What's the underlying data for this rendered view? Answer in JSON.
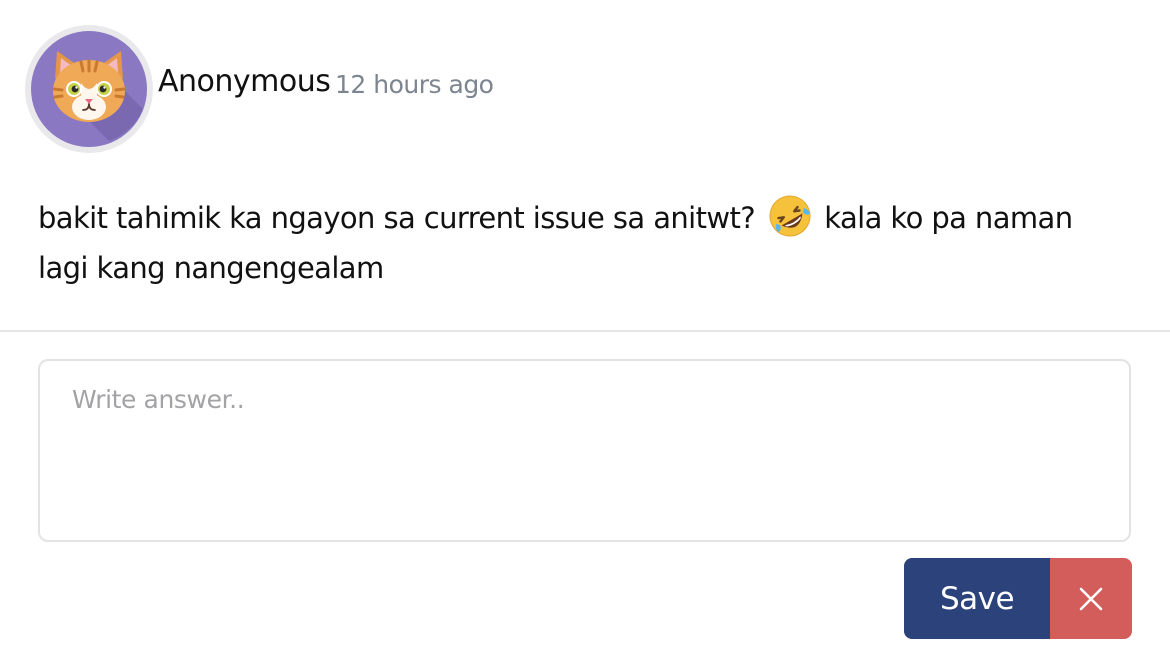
{
  "post": {
    "author": "Anonymous",
    "time": "12 hours ago",
    "avatar_icon": "cat-avatar-icon",
    "question_before_emoji": "bakit tahimik ka ngayon sa current issue sa anitwt?",
    "emoji": "rolling-on-floor-laughing-emoji",
    "question_after_emoji": "kala ko pa naman lagi kang nangengealam"
  },
  "answer": {
    "placeholder": "Write answer..",
    "value": ""
  },
  "actions": {
    "save_label": "Save",
    "close_icon": "close-icon"
  },
  "colors": {
    "avatar_bg": "#8b78c2",
    "save_bg": "#2b427a",
    "close_bg": "#d35d5a",
    "muted_text": "#7c8590"
  }
}
